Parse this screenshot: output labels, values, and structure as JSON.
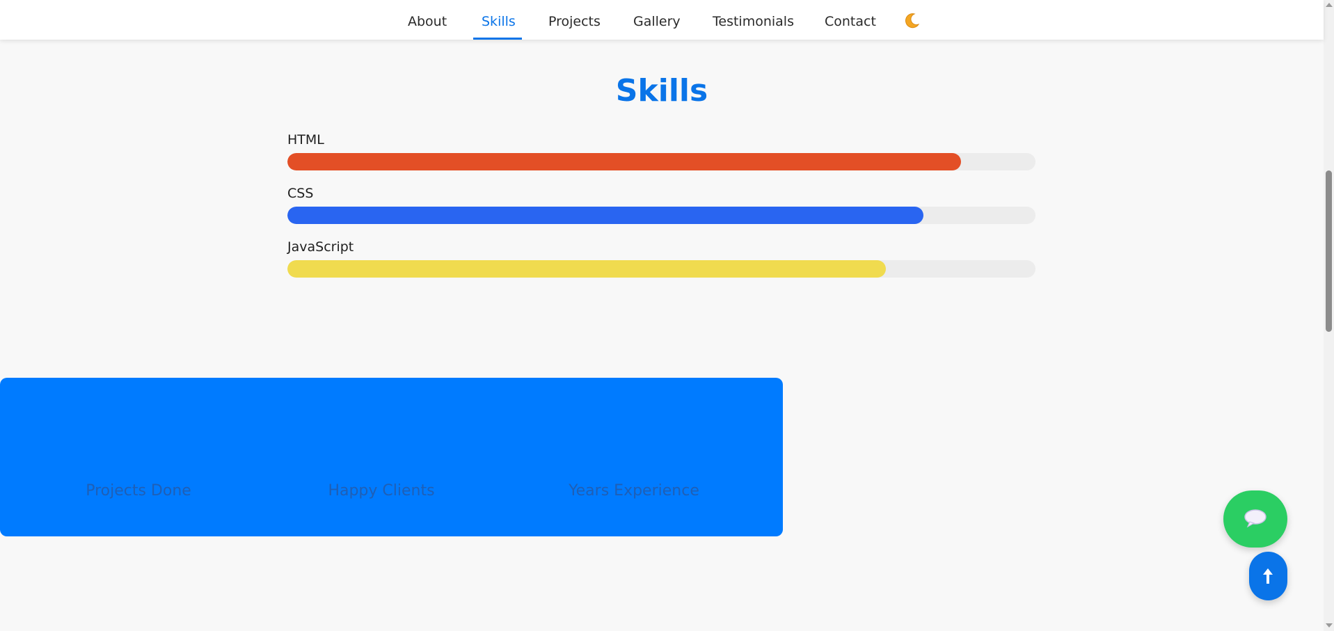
{
  "nav": {
    "items": [
      {
        "label": "About",
        "active": false
      },
      {
        "label": "Skills",
        "active": true
      },
      {
        "label": "Projects",
        "active": false
      },
      {
        "label": "Gallery",
        "active": false
      },
      {
        "label": "Testimonials",
        "active": false
      },
      {
        "label": "Contact",
        "active": false
      }
    ],
    "theme_toggle_icon": "moon-icon"
  },
  "skills": {
    "title": "Skills",
    "items": [
      {
        "name": "HTML",
        "level_percent": 90,
        "color": "#e34f26"
      },
      {
        "name": "CSS",
        "level_percent": 85,
        "color": "#2965f1"
      },
      {
        "name": "JavaScript",
        "level_percent": 80,
        "color": "#f0db4f"
      }
    ]
  },
  "stats": {
    "background_color": "#007bff",
    "items": [
      {
        "label": "Projects Done"
      },
      {
        "label": "Happy Clients"
      },
      {
        "label": "Years Experience"
      }
    ]
  },
  "floating": {
    "chat_icon": "chat-bubble-icon",
    "chat_color": "#2bce63",
    "top_icon": "arrow-up-icon",
    "top_color": "#0a74e8"
  },
  "colors": {
    "accent": "#0a74e8",
    "page_background": "#f8f8f8"
  }
}
